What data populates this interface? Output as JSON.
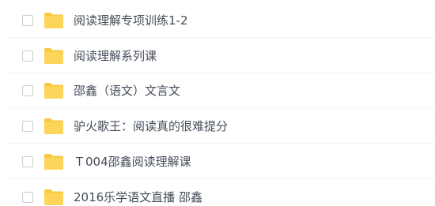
{
  "files": [
    {
      "name": "阅读理解专项训练1-2",
      "icon": "folder-icon"
    },
    {
      "name": "阅读理解系列课",
      "icon": "folder-icon"
    },
    {
      "name": "邵鑫（语文）文言文",
      "icon": "folder-icon"
    },
    {
      "name": "驴火歌王：阅读真的很难提分",
      "icon": "folder-icon"
    },
    {
      "name": "Ｔ004邵鑫阅读理解课",
      "icon": "folder-icon"
    },
    {
      "name": "2016乐学语文直播 邵鑫",
      "icon": "folder-icon"
    }
  ],
  "colors": {
    "folder_back": "#f9c83e",
    "folder_front": "#fcd55a",
    "text": "#454d5a",
    "checkbox_border": "#c9ccd2",
    "divider": "#f1f2f4"
  }
}
